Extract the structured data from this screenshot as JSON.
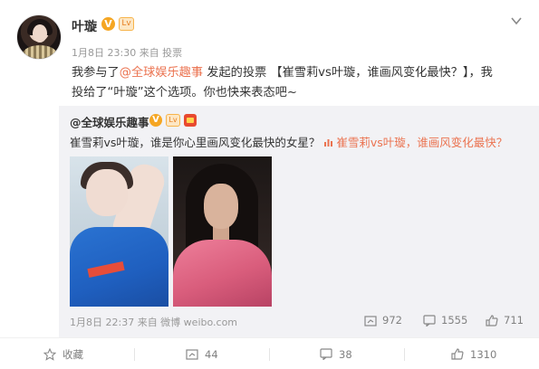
{
  "post": {
    "username": "叶璇",
    "vip_badge": "V",
    "level_badge": "Lv",
    "meta": "1月8日 23:30 来自 投票",
    "content": {
      "prefix": "我参与了",
      "mention": "@全球娱乐趣事",
      "middle": " 发起的投票 ",
      "vote_title": "【崔雪莉vs叶璇，谁画风变化最快？】",
      "suffix_line1": "，我",
      "line2": "投给了“叶璇”这个选项。你也快来表态吧~"
    }
  },
  "repost": {
    "username": "@全球娱乐趣事",
    "text": "崔雪莉vs叶璇，谁是你心里画风变化最快的女星？ ",
    "vote_link": "崔雪莉vs叶璇，谁画风变化最快？",
    "time_source": "1月8日 22:37 来自 微博 weibo.com",
    "reposts": "972",
    "comments": "1555",
    "likes": "711"
  },
  "actions": {
    "favorite": "收藏",
    "repost": "44",
    "comment": "38",
    "like": "1310"
  },
  "colors": {
    "link": "#eb7350",
    "meta_gray": "#999999",
    "repost_bg": "#f2f2f5",
    "badge_orange": "#f5a623"
  },
  "icons": [
    "chevron-down-icon",
    "vote-icon",
    "repost-icon",
    "comment-icon",
    "like-icon",
    "favorite-icon"
  ]
}
